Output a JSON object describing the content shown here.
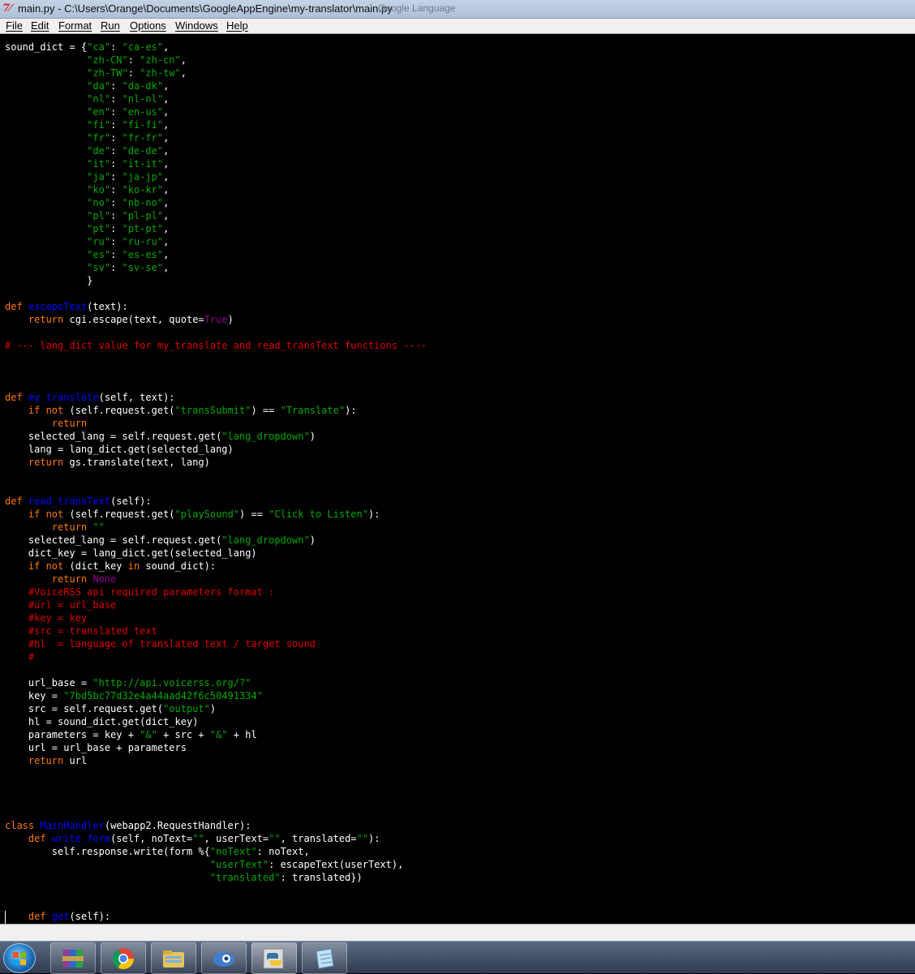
{
  "window": {
    "title": "main.py - C:\\Users\\Orange\\Documents\\GoogleAppEngine\\my-translator\\main.py",
    "background_title_ghost": "Google Language"
  },
  "menu": [
    "File",
    "Edit",
    "Format",
    "Run",
    "Options",
    "Windows",
    "Help"
  ],
  "colors": {
    "keyword": "#ff7700",
    "string": "#00aa00",
    "comment": "#dd0000",
    "definition": "#0000ff",
    "builtin": "#900090",
    "editor_bg": "#000000",
    "text": "#ffffff"
  },
  "code_lines": [
    [
      [
        "n",
        "sound_dict = {"
      ],
      [
        "s",
        "\"ca\""
      ],
      [
        "n",
        ": "
      ],
      [
        "s",
        "\"ca-es\""
      ],
      [
        "n",
        ","
      ]
    ],
    [
      [
        "n",
        "              "
      ],
      [
        "s",
        "\"zh-CN\""
      ],
      [
        "n",
        ": "
      ],
      [
        "s",
        "\"zh-cn\""
      ],
      [
        "n",
        ","
      ]
    ],
    [
      [
        "n",
        "              "
      ],
      [
        "s",
        "\"zh-TW\""
      ],
      [
        "n",
        ": "
      ],
      [
        "s",
        "\"zh-tw\""
      ],
      [
        "n",
        ","
      ]
    ],
    [
      [
        "n",
        "              "
      ],
      [
        "s",
        "\"da\""
      ],
      [
        "n",
        ": "
      ],
      [
        "s",
        "\"da-dk\""
      ],
      [
        "n",
        ","
      ]
    ],
    [
      [
        "n",
        "              "
      ],
      [
        "s",
        "\"nl\""
      ],
      [
        "n",
        ": "
      ],
      [
        "s",
        "\"nl-nl\""
      ],
      [
        "n",
        ","
      ]
    ],
    [
      [
        "n",
        "              "
      ],
      [
        "s",
        "\"en\""
      ],
      [
        "n",
        ": "
      ],
      [
        "s",
        "\"en-us\""
      ],
      [
        "n",
        ","
      ]
    ],
    [
      [
        "n",
        "              "
      ],
      [
        "s",
        "\"fi\""
      ],
      [
        "n",
        ": "
      ],
      [
        "s",
        "\"fi-fi\""
      ],
      [
        "n",
        ","
      ]
    ],
    [
      [
        "n",
        "              "
      ],
      [
        "s",
        "\"fr\""
      ],
      [
        "n",
        ": "
      ],
      [
        "s",
        "\"fr-fr\""
      ],
      [
        "n",
        ","
      ]
    ],
    [
      [
        "n",
        "              "
      ],
      [
        "s",
        "\"de\""
      ],
      [
        "n",
        ": "
      ],
      [
        "s",
        "\"de-de\""
      ],
      [
        "n",
        ","
      ]
    ],
    [
      [
        "n",
        "              "
      ],
      [
        "s",
        "\"it\""
      ],
      [
        "n",
        ": "
      ],
      [
        "s",
        "\"it-it\""
      ],
      [
        "n",
        ","
      ]
    ],
    [
      [
        "n",
        "              "
      ],
      [
        "s",
        "\"ja\""
      ],
      [
        "n",
        ": "
      ],
      [
        "s",
        "\"ja-jp\""
      ],
      [
        "n",
        ","
      ]
    ],
    [
      [
        "n",
        "              "
      ],
      [
        "s",
        "\"ko\""
      ],
      [
        "n",
        ": "
      ],
      [
        "s",
        "\"ko-kr\""
      ],
      [
        "n",
        ","
      ]
    ],
    [
      [
        "n",
        "              "
      ],
      [
        "s",
        "\"no\""
      ],
      [
        "n",
        ": "
      ],
      [
        "s",
        "\"nb-no\""
      ],
      [
        "n",
        ","
      ]
    ],
    [
      [
        "n",
        "              "
      ],
      [
        "s",
        "\"pl\""
      ],
      [
        "n",
        ": "
      ],
      [
        "s",
        "\"pl-pl\""
      ],
      [
        "n",
        ","
      ]
    ],
    [
      [
        "n",
        "              "
      ],
      [
        "s",
        "\"pt\""
      ],
      [
        "n",
        ": "
      ],
      [
        "s",
        "\"pt-pt\""
      ],
      [
        "n",
        ","
      ]
    ],
    [
      [
        "n",
        "              "
      ],
      [
        "s",
        "\"ru\""
      ],
      [
        "n",
        ": "
      ],
      [
        "s",
        "\"ru-ru\""
      ],
      [
        "n",
        ","
      ]
    ],
    [
      [
        "n",
        "              "
      ],
      [
        "s",
        "\"es\""
      ],
      [
        "n",
        ": "
      ],
      [
        "s",
        "\"es-es\""
      ],
      [
        "n",
        ","
      ]
    ],
    [
      [
        "n",
        "              "
      ],
      [
        "s",
        "\"sv\""
      ],
      [
        "n",
        ": "
      ],
      [
        "s",
        "\"sv-se\""
      ],
      [
        "n",
        ","
      ]
    ],
    [
      [
        "n",
        "              }"
      ]
    ],
    [],
    [
      [
        "k",
        "def "
      ],
      [
        "d",
        "escapeText"
      ],
      [
        "n",
        "(text):"
      ]
    ],
    [
      [
        "n",
        "    "
      ],
      [
        "k",
        "return"
      ],
      [
        "n",
        " cgi.escape(text, quote="
      ],
      [
        "b",
        "True"
      ],
      [
        "n",
        ")"
      ]
    ],
    [],
    [
      [
        "c",
        "# --- lang_dict value for my_translate and read_transText functions ----"
      ]
    ],
    [],
    [],
    [],
    [
      [
        "k",
        "def "
      ],
      [
        "d",
        "my_translate"
      ],
      [
        "n",
        "(self, text):"
      ]
    ],
    [
      [
        "n",
        "    "
      ],
      [
        "k",
        "if not"
      ],
      [
        "n",
        " (self.request.get("
      ],
      [
        "s",
        "\"transSubmit\""
      ],
      [
        "n",
        ") == "
      ],
      [
        "s",
        "\"Translate\""
      ],
      [
        "n",
        "):"
      ]
    ],
    [
      [
        "n",
        "        "
      ],
      [
        "k",
        "return"
      ]
    ],
    [
      [
        "n",
        "    selected_lang = self.request.get("
      ],
      [
        "s",
        "\"lang_dropdown\""
      ],
      [
        "n",
        ")"
      ]
    ],
    [
      [
        "n",
        "    lang = lang_dict.get(selected_lang)"
      ]
    ],
    [
      [
        "n",
        "    "
      ],
      [
        "k",
        "return"
      ],
      [
        "n",
        " gs.translate(text, lang)"
      ]
    ],
    [],
    [],
    [
      [
        "k",
        "def "
      ],
      [
        "d",
        "read_transText"
      ],
      [
        "n",
        "(self):"
      ]
    ],
    [
      [
        "n",
        "    "
      ],
      [
        "k",
        "if not"
      ],
      [
        "n",
        " (self.request.get("
      ],
      [
        "s",
        "\"playSound\""
      ],
      [
        "n",
        ") == "
      ],
      [
        "s",
        "\"Click to Listen\""
      ],
      [
        "n",
        "):"
      ]
    ],
    [
      [
        "n",
        "        "
      ],
      [
        "k",
        "return"
      ],
      [
        "n",
        " "
      ],
      [
        "s",
        "\"\""
      ]
    ],
    [
      [
        "n",
        "    selected_lang = self.request.get("
      ],
      [
        "s",
        "\"lang_dropdown\""
      ],
      [
        "n",
        ")"
      ]
    ],
    [
      [
        "n",
        "    dict_key = lang_dict.get(selected_lang)"
      ]
    ],
    [
      [
        "n",
        "    "
      ],
      [
        "k",
        "if not"
      ],
      [
        "n",
        " (dict_key "
      ],
      [
        "k",
        "in"
      ],
      [
        "n",
        " sound_dict):"
      ]
    ],
    [
      [
        "n",
        "        "
      ],
      [
        "k",
        "return"
      ],
      [
        "n",
        " "
      ],
      [
        "b",
        "None"
      ]
    ],
    [
      [
        "n",
        "    "
      ],
      [
        "c",
        "#VoiceRSS api required parameters format :"
      ]
    ],
    [
      [
        "n",
        "    "
      ],
      [
        "c",
        "#url = url_base"
      ]
    ],
    [
      [
        "n",
        "    "
      ],
      [
        "c",
        "#key = key"
      ]
    ],
    [
      [
        "n",
        "    "
      ],
      [
        "c",
        "#src = translated text"
      ]
    ],
    [
      [
        "n",
        "    "
      ],
      [
        "c",
        "#hl  = language of translated text / target sound"
      ]
    ],
    [
      [
        "n",
        "    "
      ],
      [
        "c",
        "#"
      ]
    ],
    [],
    [
      [
        "n",
        "    url_base = "
      ],
      [
        "s",
        "\"http://api.voicerss.org/?\""
      ]
    ],
    [
      [
        "n",
        "    key = "
      ],
      [
        "s",
        "\"7bd5bc77d32e4a44aad42f6c50491334\""
      ]
    ],
    [
      [
        "n",
        "    src = self.request.get("
      ],
      [
        "s",
        "\"output\""
      ],
      [
        "n",
        ")"
      ]
    ],
    [
      [
        "n",
        "    hl = sound_dict.get(dict_key)"
      ]
    ],
    [
      [
        "n",
        "    parameters = key + "
      ],
      [
        "s",
        "\"&\""
      ],
      [
        "n",
        " + src + "
      ],
      [
        "s",
        "\"&\""
      ],
      [
        "n",
        " + hl"
      ]
    ],
    [
      [
        "n",
        "    url = url_base + parameters"
      ]
    ],
    [
      [
        "n",
        "    "
      ],
      [
        "k",
        "return"
      ],
      [
        "n",
        " url"
      ]
    ],
    [],
    [],
    [],
    [],
    [
      [
        "k",
        "class "
      ],
      [
        "d",
        "MainHandler"
      ],
      [
        "n",
        "(webapp2.RequestHandler):"
      ]
    ],
    [
      [
        "n",
        "    "
      ],
      [
        "k",
        "def "
      ],
      [
        "d",
        "write_form"
      ],
      [
        "n",
        "(self, noText="
      ],
      [
        "s",
        "\"\""
      ],
      [
        "n",
        ", userText="
      ],
      [
        "s",
        "\"\""
      ],
      [
        "n",
        ", translated="
      ],
      [
        "s",
        "\"\""
      ],
      [
        "n",
        "):"
      ]
    ],
    [
      [
        "n",
        "        self.response.write(form %{"
      ],
      [
        "s",
        "\"noText\""
      ],
      [
        "n",
        ": noText,"
      ]
    ],
    [
      [
        "n",
        "                                   "
      ],
      [
        "s",
        "\"userText\""
      ],
      [
        "n",
        ": escapeText(userText),"
      ]
    ],
    [
      [
        "n",
        "                                   "
      ],
      [
        "s",
        "\"translated\""
      ],
      [
        "n",
        ": translated})"
      ]
    ],
    [],
    [],
    [
      [
        "n",
        "    "
      ],
      [
        "k",
        "def "
      ],
      [
        "d",
        "get"
      ],
      [
        "n",
        "(self):"
      ]
    ]
  ],
  "taskbar": {
    "items": [
      "start-button",
      "winrar-icon",
      "chrome-icon",
      "explorer-icon",
      "app-icon",
      "python-idle-icon",
      "notepad-icon"
    ]
  }
}
